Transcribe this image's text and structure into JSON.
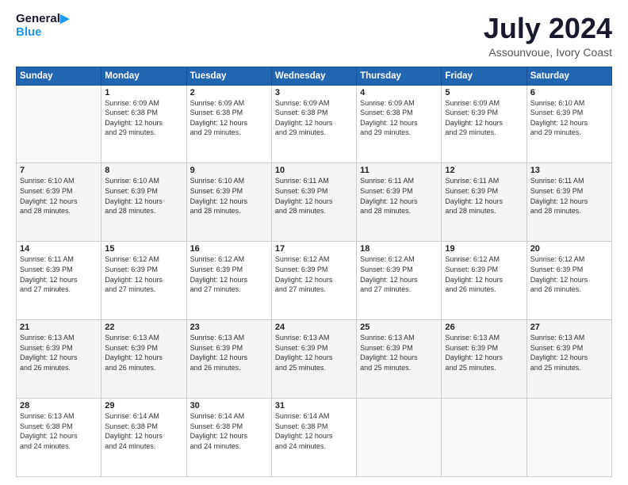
{
  "logo": {
    "line1": "General",
    "line2": "Blue"
  },
  "title": "July 2024",
  "subtitle": "Assounvoue, Ivory Coast",
  "weekdays": [
    "Sunday",
    "Monday",
    "Tuesday",
    "Wednesday",
    "Thursday",
    "Friday",
    "Saturday"
  ],
  "rows": [
    [
      {
        "day": "",
        "sunrise": "",
        "sunset": "",
        "daylight": "",
        "dl2": ""
      },
      {
        "day": "1",
        "sunrise": "Sunrise: 6:09 AM",
        "sunset": "Sunset: 6:38 PM",
        "daylight": "Daylight: 12 hours",
        "dl2": "and 29 minutes."
      },
      {
        "day": "2",
        "sunrise": "Sunrise: 6:09 AM",
        "sunset": "Sunset: 6:38 PM",
        "daylight": "Daylight: 12 hours",
        "dl2": "and 29 minutes."
      },
      {
        "day": "3",
        "sunrise": "Sunrise: 6:09 AM",
        "sunset": "Sunset: 6:38 PM",
        "daylight": "Daylight: 12 hours",
        "dl2": "and 29 minutes."
      },
      {
        "day": "4",
        "sunrise": "Sunrise: 6:09 AM",
        "sunset": "Sunset: 6:38 PM",
        "daylight": "Daylight: 12 hours",
        "dl2": "and 29 minutes."
      },
      {
        "day": "5",
        "sunrise": "Sunrise: 6:09 AM",
        "sunset": "Sunset: 6:39 PM",
        "daylight": "Daylight: 12 hours",
        "dl2": "and 29 minutes."
      },
      {
        "day": "6",
        "sunrise": "Sunrise: 6:10 AM",
        "sunset": "Sunset: 6:39 PM",
        "daylight": "Daylight: 12 hours",
        "dl2": "and 29 minutes."
      }
    ],
    [
      {
        "day": "7",
        "sunrise": "Sunrise: 6:10 AM",
        "sunset": "Sunset: 6:39 PM",
        "daylight": "Daylight: 12 hours",
        "dl2": "and 28 minutes."
      },
      {
        "day": "8",
        "sunrise": "Sunrise: 6:10 AM",
        "sunset": "Sunset: 6:39 PM",
        "daylight": "Daylight: 12 hours",
        "dl2": "and 28 minutes."
      },
      {
        "day": "9",
        "sunrise": "Sunrise: 6:10 AM",
        "sunset": "Sunset: 6:39 PM",
        "daylight": "Daylight: 12 hours",
        "dl2": "and 28 minutes."
      },
      {
        "day": "10",
        "sunrise": "Sunrise: 6:11 AM",
        "sunset": "Sunset: 6:39 PM",
        "daylight": "Daylight: 12 hours",
        "dl2": "and 28 minutes."
      },
      {
        "day": "11",
        "sunrise": "Sunrise: 6:11 AM",
        "sunset": "Sunset: 6:39 PM",
        "daylight": "Daylight: 12 hours",
        "dl2": "and 28 minutes."
      },
      {
        "day": "12",
        "sunrise": "Sunrise: 6:11 AM",
        "sunset": "Sunset: 6:39 PM",
        "daylight": "Daylight: 12 hours",
        "dl2": "and 28 minutes."
      },
      {
        "day": "13",
        "sunrise": "Sunrise: 6:11 AM",
        "sunset": "Sunset: 6:39 PM",
        "daylight": "Daylight: 12 hours",
        "dl2": "and 28 minutes."
      }
    ],
    [
      {
        "day": "14",
        "sunrise": "Sunrise: 6:11 AM",
        "sunset": "Sunset: 6:39 PM",
        "daylight": "Daylight: 12 hours",
        "dl2": "and 27 minutes."
      },
      {
        "day": "15",
        "sunrise": "Sunrise: 6:12 AM",
        "sunset": "Sunset: 6:39 PM",
        "daylight": "Daylight: 12 hours",
        "dl2": "and 27 minutes."
      },
      {
        "day": "16",
        "sunrise": "Sunrise: 6:12 AM",
        "sunset": "Sunset: 6:39 PM",
        "daylight": "Daylight: 12 hours",
        "dl2": "and 27 minutes."
      },
      {
        "day": "17",
        "sunrise": "Sunrise: 6:12 AM",
        "sunset": "Sunset: 6:39 PM",
        "daylight": "Daylight: 12 hours",
        "dl2": "and 27 minutes."
      },
      {
        "day": "18",
        "sunrise": "Sunrise: 6:12 AM",
        "sunset": "Sunset: 6:39 PM",
        "daylight": "Daylight: 12 hours",
        "dl2": "and 27 minutes."
      },
      {
        "day": "19",
        "sunrise": "Sunrise: 6:12 AM",
        "sunset": "Sunset: 6:39 PM",
        "daylight": "Daylight: 12 hours",
        "dl2": "and 26 minutes."
      },
      {
        "day": "20",
        "sunrise": "Sunrise: 6:12 AM",
        "sunset": "Sunset: 6:39 PM",
        "daylight": "Daylight: 12 hours",
        "dl2": "and 26 minutes."
      }
    ],
    [
      {
        "day": "21",
        "sunrise": "Sunrise: 6:13 AM",
        "sunset": "Sunset: 6:39 PM",
        "daylight": "Daylight: 12 hours",
        "dl2": "and 26 minutes."
      },
      {
        "day": "22",
        "sunrise": "Sunrise: 6:13 AM",
        "sunset": "Sunset: 6:39 PM",
        "daylight": "Daylight: 12 hours",
        "dl2": "and 26 minutes."
      },
      {
        "day": "23",
        "sunrise": "Sunrise: 6:13 AM",
        "sunset": "Sunset: 6:39 PM",
        "daylight": "Daylight: 12 hours",
        "dl2": "and 26 minutes."
      },
      {
        "day": "24",
        "sunrise": "Sunrise: 6:13 AM",
        "sunset": "Sunset: 6:39 PM",
        "daylight": "Daylight: 12 hours",
        "dl2": "and 25 minutes."
      },
      {
        "day": "25",
        "sunrise": "Sunrise: 6:13 AM",
        "sunset": "Sunset: 6:39 PM",
        "daylight": "Daylight: 12 hours",
        "dl2": "and 25 minutes."
      },
      {
        "day": "26",
        "sunrise": "Sunrise: 6:13 AM",
        "sunset": "Sunset: 6:39 PM",
        "daylight": "Daylight: 12 hours",
        "dl2": "and 25 minutes."
      },
      {
        "day": "27",
        "sunrise": "Sunrise: 6:13 AM",
        "sunset": "Sunset: 6:39 PM",
        "daylight": "Daylight: 12 hours",
        "dl2": "and 25 minutes."
      }
    ],
    [
      {
        "day": "28",
        "sunrise": "Sunrise: 6:13 AM",
        "sunset": "Sunset: 6:38 PM",
        "daylight": "Daylight: 12 hours",
        "dl2": "and 24 minutes."
      },
      {
        "day": "29",
        "sunrise": "Sunrise: 6:14 AM",
        "sunset": "Sunset: 6:38 PM",
        "daylight": "Daylight: 12 hours",
        "dl2": "and 24 minutes."
      },
      {
        "day": "30",
        "sunrise": "Sunrise: 6:14 AM",
        "sunset": "Sunset: 6:38 PM",
        "daylight": "Daylight: 12 hours",
        "dl2": "and 24 minutes."
      },
      {
        "day": "31",
        "sunrise": "Sunrise: 6:14 AM",
        "sunset": "Sunset: 6:38 PM",
        "daylight": "Daylight: 12 hours",
        "dl2": "and 24 minutes."
      },
      {
        "day": "",
        "sunrise": "",
        "sunset": "",
        "daylight": "",
        "dl2": ""
      },
      {
        "day": "",
        "sunrise": "",
        "sunset": "",
        "daylight": "",
        "dl2": ""
      },
      {
        "day": "",
        "sunrise": "",
        "sunset": "",
        "daylight": "",
        "dl2": ""
      }
    ]
  ]
}
